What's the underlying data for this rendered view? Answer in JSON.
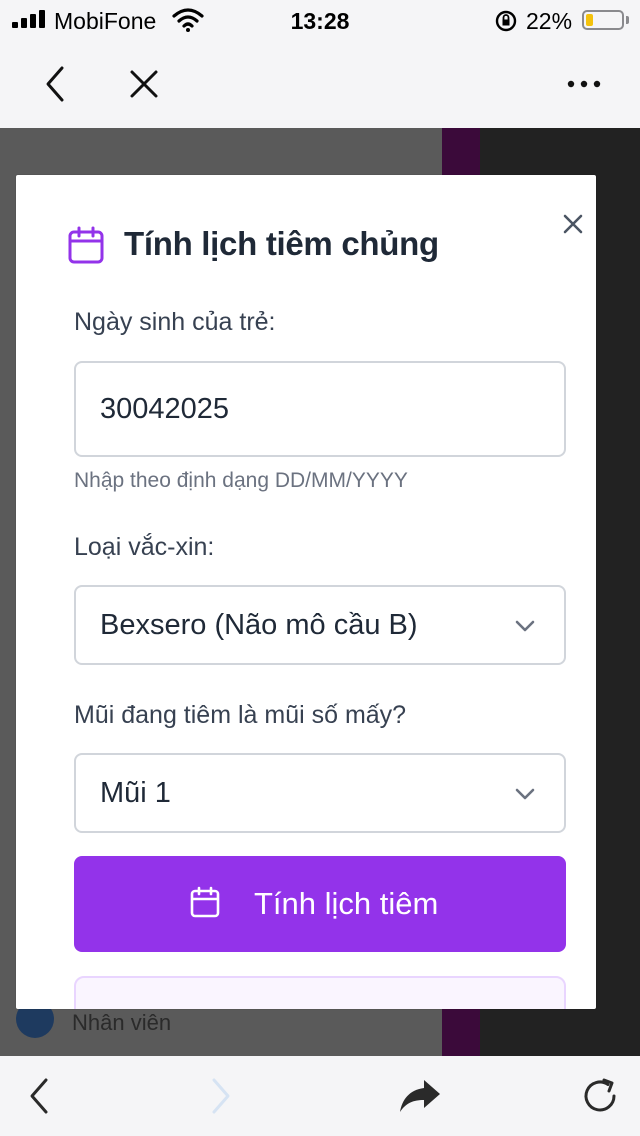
{
  "status_bar": {
    "carrier": "MobiFone",
    "time": "13:28",
    "battery_percent": "22%",
    "battery_level": 0.22,
    "icons": [
      "signal-icon",
      "wifi-icon",
      "rotation-lock-icon",
      "battery-icon"
    ]
  },
  "browser_toolbar": {
    "icons": [
      "back-icon",
      "close-icon",
      "more-icon"
    ]
  },
  "background_page": {
    "footer_text": "Nhân viên"
  },
  "modal": {
    "title": "Tính lịch tiêm chủng",
    "title_icon": "calendar-icon",
    "close_icon": "close-icon",
    "birthdate": {
      "label": "Ngày sinh của trẻ:",
      "value": "30042025",
      "hint": "Nhập theo định dạng DD/MM/YYYY"
    },
    "vaccine": {
      "label": "Loại vắc-xin:",
      "selected": "Bexsero (Não mô cầu B)"
    },
    "dose": {
      "label": "Mũi đang tiêm là mũi số mấy?",
      "selected": "Mũi 1"
    },
    "submit": {
      "label": "Tính lịch tiêm",
      "icon": "calendar-icon"
    }
  },
  "bottom_toolbar": {
    "icons": [
      "back-icon",
      "forward-icon",
      "share-icon",
      "reload-icon"
    ]
  },
  "colors": {
    "accent": "#9333ea",
    "result_border": "#e9d5ff",
    "result_bg": "#faf5ff",
    "battery_fill": "#f4c20d"
  }
}
